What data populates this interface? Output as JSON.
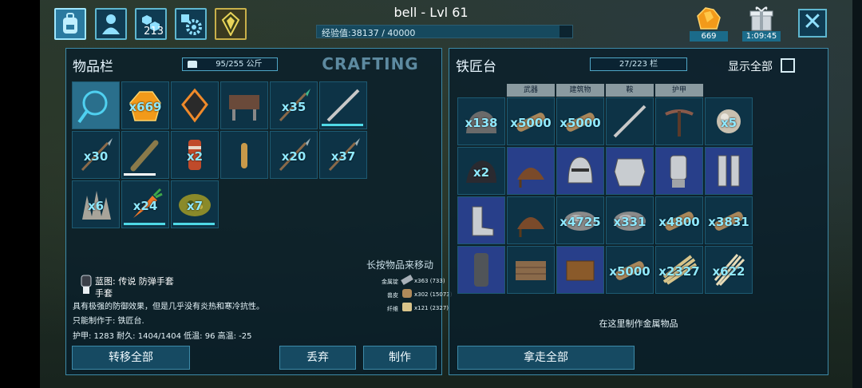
{
  "header": {
    "player_title": "bell - Lvl 61",
    "xp_text": "经验值:38137 / 40000",
    "xp_fraction": 0.95,
    "engram_points": "213",
    "resource_count": "669",
    "timer": "1:09:45",
    "close_glyph": "✕"
  },
  "inventory": {
    "title": "物品栏",
    "weight": "95/255 公斤",
    "crafting_tab": "CRAFTING",
    "slots": [
      {
        "icon": "magnifier-icon",
        "qty": ""
      },
      {
        "icon": "amber-icon",
        "qty": "x669"
      },
      {
        "icon": "artifact-icon",
        "qty": ""
      },
      {
        "icon": "smithy-icon",
        "qty": ""
      },
      {
        "icon": "spear-icon",
        "qty": "x35"
      },
      {
        "icon": "pike-icon",
        "qty": ""
      },
      {
        "icon": "arrow-icon",
        "qty": "x30"
      },
      {
        "icon": "club-icon",
        "qty": ""
      },
      {
        "icon": "canister-icon",
        "qty": "x2"
      },
      {
        "icon": "bullet-icon",
        "qty": ""
      },
      {
        "icon": "arrow-icon",
        "qty": "x20"
      },
      {
        "icon": "arrow-icon",
        "qty": "x37"
      },
      {
        "icon": "crystal-icon",
        "qty": "x6"
      },
      {
        "icon": "carrot-icon",
        "qty": "x24"
      },
      {
        "icon": "kibble-icon",
        "qty": "x7"
      }
    ],
    "hint": "长按物品来移动",
    "detail": {
      "blueprint_name": "蓝图: 传说 防弹手套",
      "sub_name": "手套",
      "desc1": "具有极强的防御效果，但是几乎没有炎热和寒冷抗性。",
      "desc2": "只能制作于: 铁匠台.",
      "stats": "护甲: 1283  耐久: 1404/1404  低温: 96  高温: -25",
      "req1_label": "金属锭",
      "req1_value": "x363 (733)",
      "req2_label": "兽皮",
      "req2_value": "x302 (15073)",
      "req3_label": "纤维",
      "req3_value": "x121 (2327)"
    },
    "buttons": {
      "transfer_all": "转移全部",
      "drop": "丢弃",
      "craft": "制作"
    }
  },
  "smithy": {
    "title": "铁匠台",
    "capacity": "27/223 栏",
    "show_all": "显示全部",
    "categories": [
      "武器",
      "建筑物",
      "鞍",
      "护甲"
    ],
    "slots": [
      {
        "icon": "stone-icon",
        "qty": "x138"
      },
      {
        "icon": "wood-icon",
        "qty": "x5000"
      },
      {
        "icon": "wood-icon",
        "qty": "x5000"
      },
      {
        "icon": "pike-icon",
        "qty": ""
      },
      {
        "icon": "crossbow-icon",
        "qty": ""
      },
      {
        "icon": "sphere-icon",
        "qty": "x5"
      },
      {
        "icon": "obsidian-icon",
        "qty": "x2"
      },
      {
        "icon": "saddle-icon",
        "qty": ""
      },
      {
        "icon": "helmet-icon",
        "qty": ""
      },
      {
        "icon": "chestplate-icon",
        "qty": ""
      },
      {
        "icon": "gauntlet-icon",
        "qty": ""
      },
      {
        "icon": "leggings-icon",
        "qty": ""
      },
      {
        "icon": "boots-icon",
        "qty": ""
      },
      {
        "icon": "saddle-icon",
        "qty": ""
      },
      {
        "icon": "metal-icon",
        "qty": "x4725"
      },
      {
        "icon": "metal-icon",
        "qty": "x331"
      },
      {
        "icon": "wood-icon",
        "qty": "x4800"
      },
      {
        "icon": "wood-icon",
        "qty": "x3831"
      },
      {
        "icon": "tube-icon",
        "qty": ""
      },
      {
        "icon": "floor-icon",
        "qty": ""
      },
      {
        "icon": "box-icon",
        "qty": ""
      },
      {
        "icon": "wood-icon",
        "qty": "x5000"
      },
      {
        "icon": "thatch-icon",
        "qty": "x2327"
      },
      {
        "icon": "fiber-icon",
        "qty": "x622"
      }
    ],
    "footer_hint": "在这里制作金属物品",
    "take_all": "拿走全部"
  },
  "colors": {
    "panel_border": "#3d8aa8",
    "accent": "#8fe9ff",
    "amber": "#f29a1a"
  }
}
